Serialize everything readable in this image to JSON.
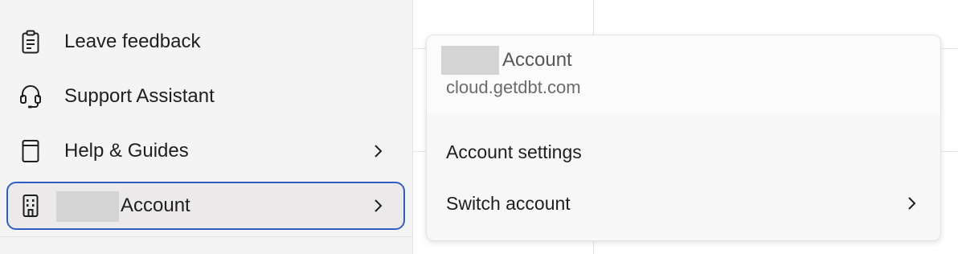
{
  "sidebar": {
    "items": [
      {
        "label": "Leave feedback",
        "icon": "clipboard-icon",
        "has_submenu": false
      },
      {
        "label": "Support Assistant",
        "icon": "headset-icon",
        "has_submenu": false
      },
      {
        "label": "Help & Guides",
        "icon": "book-icon",
        "has_submenu": true
      },
      {
        "label": "Account",
        "icon": "building-icon",
        "has_submenu": true,
        "selected": true,
        "redacted_prefix": true
      }
    ]
  },
  "account_popover": {
    "account_name": "Account",
    "account_name_redacted_prefix": true,
    "domain": "cloud.getdbt.com",
    "items": [
      {
        "label": "Account settings",
        "has_submenu": false
      },
      {
        "label": "Switch account",
        "has_submenu": true
      }
    ]
  },
  "colors": {
    "selection_border": "#2f5ec4",
    "sidebar_bg": "#f4f4f4",
    "redaction": "#d4d4d4"
  }
}
